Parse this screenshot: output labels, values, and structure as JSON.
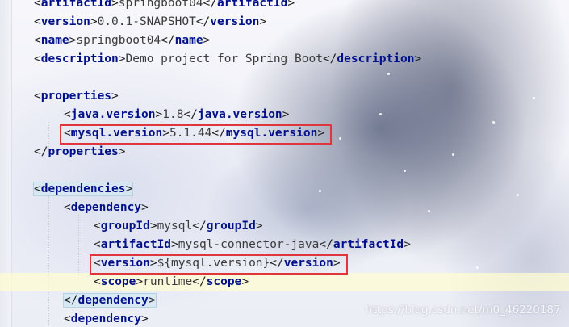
{
  "editor": {
    "lines": [
      {
        "indent": 1,
        "tag": "artifactId",
        "value": "springboot04"
      },
      {
        "indent": 1,
        "tag": "version",
        "value": "0.0.1-SNAPSHOT"
      },
      {
        "indent": 1,
        "tag": "name",
        "value": "springboot04"
      },
      {
        "indent": 1,
        "tag": "description",
        "value": "Demo project for Spring Boot"
      },
      {
        "indent": 1,
        "tag": "",
        "value": ""
      },
      {
        "indent": 1,
        "tag": "properties",
        "kind": "open"
      },
      {
        "indent": 2,
        "tag": "java.version",
        "value": "1.8"
      },
      {
        "indent": 2,
        "tag": "mysql.version",
        "value": "5.1.44",
        "boxed": true
      },
      {
        "indent": 1,
        "tag": "properties",
        "kind": "close"
      },
      {
        "indent": 1,
        "tag": "",
        "value": ""
      },
      {
        "indent": 1,
        "tag": "dependencies",
        "kind": "open",
        "highlight": true
      },
      {
        "indent": 2,
        "tag": "dependency",
        "kind": "open"
      },
      {
        "indent": 3,
        "tag": "groupId",
        "value": "mysql"
      },
      {
        "indent": 3,
        "tag": "artifactId",
        "value": "mysql-connector-java"
      },
      {
        "indent": 3,
        "tag": "version",
        "value": "${mysql.version}",
        "boxed": true
      },
      {
        "indent": 3,
        "tag": "scope",
        "value": "runtime",
        "current": true
      },
      {
        "indent": 2,
        "tag": "dependency",
        "kind": "close",
        "highlight": true
      },
      {
        "indent": 2,
        "tag": "dependency",
        "kind": "open"
      }
    ]
  },
  "watermark": "https://blog.csdn.net/m0_46220187",
  "colors": {
    "tag": "#00108a",
    "highlight_box": "#e0353b",
    "current_line": "#fffcd2"
  }
}
